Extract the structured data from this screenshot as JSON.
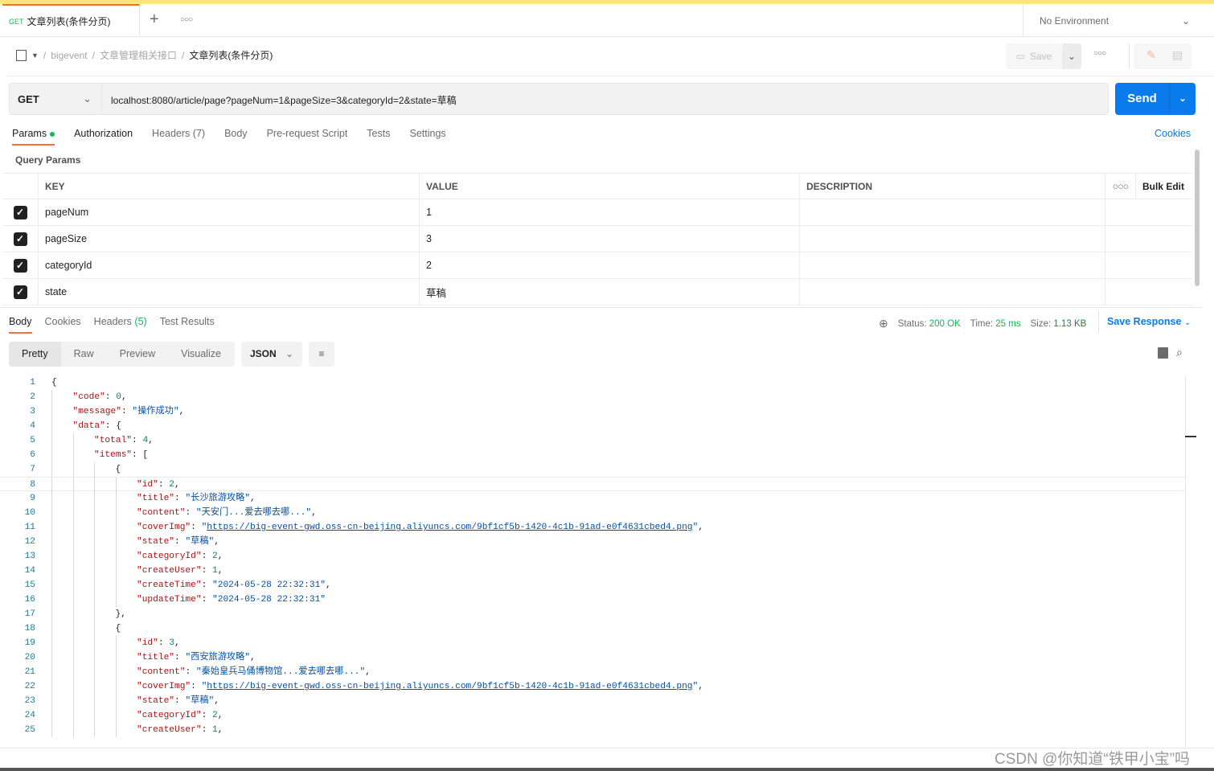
{
  "tab": {
    "method": "GET",
    "title": "文章列表(条件分页)"
  },
  "environment": "No Environment",
  "breadcrumb": [
    "bigevent",
    "文章管理相关接口",
    "文章列表(条件分页)"
  ],
  "toolbar": {
    "save": "Save"
  },
  "request": {
    "method": "GET",
    "url": "localhost:8080/article/page?pageNum=1&pageSize=3&categoryId=2&state=草稿",
    "send": "Send"
  },
  "request_tabs": {
    "params": "Params",
    "authorization": "Authorization",
    "headers": "Headers",
    "headers_count": "(7)",
    "body": "Body",
    "prerequest": "Pre-request Script",
    "tests": "Tests",
    "settings": "Settings",
    "cookies": "Cookies"
  },
  "query_params": {
    "title": "Query Params",
    "headers": {
      "key": "KEY",
      "value": "VALUE",
      "description": "DESCRIPTION",
      "bulk_edit": "Bulk Edit"
    },
    "rows": [
      {
        "key": "pageNum",
        "value": "1",
        "checked": true
      },
      {
        "key": "pageSize",
        "value": "3",
        "checked": true
      },
      {
        "key": "categoryId",
        "value": "2",
        "checked": true
      },
      {
        "key": "state",
        "value": "草稿",
        "checked": true
      }
    ]
  },
  "response_tabs": {
    "body": "Body",
    "cookies": "Cookies",
    "headers": "Headers",
    "headers_count": "(5)",
    "test_results": "Test Results"
  },
  "response_status": {
    "status_label": "Status:",
    "status": "200 OK",
    "time_label": "Time:",
    "time": "25 ms",
    "size_label": "Size:",
    "size": "1.13 KB",
    "save_response": "Save Response"
  },
  "view_modes": {
    "pretty": "Pretty",
    "raw": "Raw",
    "preview": "Preview",
    "visualize": "Visualize",
    "format": "JSON"
  },
  "code_lines": [
    {
      "n": "1",
      "i": 0,
      "t": [
        [
          "p",
          "{"
        ]
      ]
    },
    {
      "n": "2",
      "i": 1,
      "t": [
        [
          "k",
          "\"code\""
        ],
        [
          "p",
          ": "
        ],
        [
          "n",
          "0"
        ],
        [
          "p",
          ","
        ]
      ]
    },
    {
      "n": "3",
      "i": 1,
      "t": [
        [
          "k",
          "\"message\""
        ],
        [
          "p",
          ": "
        ],
        [
          "s",
          "\"操作成功\""
        ],
        [
          "p",
          ","
        ]
      ]
    },
    {
      "n": "4",
      "i": 1,
      "t": [
        [
          "k",
          "\"data\""
        ],
        [
          "p",
          ": {"
        ]
      ]
    },
    {
      "n": "5",
      "i": 2,
      "t": [
        [
          "k",
          "\"total\""
        ],
        [
          "p",
          ": "
        ],
        [
          "n",
          "4"
        ],
        [
          "p",
          ","
        ]
      ]
    },
    {
      "n": "6",
      "i": 2,
      "t": [
        [
          "k",
          "\"items\""
        ],
        [
          "p",
          ": ["
        ]
      ]
    },
    {
      "n": "7",
      "i": 3,
      "t": [
        [
          "p",
          "{"
        ]
      ]
    },
    {
      "n": "8",
      "i": 4,
      "t": [
        [
          "k",
          "\"id\""
        ],
        [
          "p",
          ": "
        ],
        [
          "n",
          "2"
        ],
        [
          "p",
          ","
        ]
      ]
    },
    {
      "n": "9",
      "i": 4,
      "t": [
        [
          "k",
          "\"title\""
        ],
        [
          "p",
          ": "
        ],
        [
          "s",
          "\"长沙旅游攻略\""
        ],
        [
          "p",
          ","
        ]
      ]
    },
    {
      "n": "10",
      "i": 4,
      "t": [
        [
          "k",
          "\"content\""
        ],
        [
          "p",
          ": "
        ],
        [
          "s",
          "\"天安门...爱去哪去哪...\""
        ],
        [
          "p",
          ","
        ]
      ]
    },
    {
      "n": "11",
      "i": 4,
      "t": [
        [
          "k",
          "\"coverImg\""
        ],
        [
          "p",
          ": "
        ],
        [
          "s",
          "\""
        ],
        [
          "u",
          "https://big-event-gwd.oss-cn-beijing.aliyuncs.com/9bf1cf5b-1420-4c1b-91ad-e0f4631cbed4.png"
        ],
        [
          "s",
          "\""
        ],
        [
          "p",
          ","
        ]
      ]
    },
    {
      "n": "12",
      "i": 4,
      "t": [
        [
          "k",
          "\"state\""
        ],
        [
          "p",
          ": "
        ],
        [
          "s",
          "\"草稿\""
        ],
        [
          "p",
          ","
        ]
      ]
    },
    {
      "n": "13",
      "i": 4,
      "t": [
        [
          "k",
          "\"categoryId\""
        ],
        [
          "p",
          ": "
        ],
        [
          "n",
          "2"
        ],
        [
          "p",
          ","
        ]
      ]
    },
    {
      "n": "14",
      "i": 4,
      "t": [
        [
          "k",
          "\"createUser\""
        ],
        [
          "p",
          ": "
        ],
        [
          "n",
          "1"
        ],
        [
          "p",
          ","
        ]
      ]
    },
    {
      "n": "15",
      "i": 4,
      "t": [
        [
          "k",
          "\"createTime\""
        ],
        [
          "p",
          ": "
        ],
        [
          "s",
          "\"2024-05-28 22:32:31\""
        ],
        [
          "p",
          ","
        ]
      ]
    },
    {
      "n": "16",
      "i": 4,
      "t": [
        [
          "k",
          "\"updateTime\""
        ],
        [
          "p",
          ": "
        ],
        [
          "s",
          "\"2024-05-28 22:32:31\""
        ]
      ]
    },
    {
      "n": "17",
      "i": 3,
      "t": [
        [
          "p",
          "},"
        ]
      ]
    },
    {
      "n": "18",
      "i": 3,
      "t": [
        [
          "p",
          "{"
        ]
      ]
    },
    {
      "n": "19",
      "i": 4,
      "t": [
        [
          "k",
          "\"id\""
        ],
        [
          "p",
          ": "
        ],
        [
          "n",
          "3"
        ],
        [
          "p",
          ","
        ]
      ]
    },
    {
      "n": "20",
      "i": 4,
      "t": [
        [
          "k",
          "\"title\""
        ],
        [
          "p",
          ": "
        ],
        [
          "s",
          "\"西安旅游攻略\""
        ],
        [
          "p",
          ","
        ]
      ]
    },
    {
      "n": "21",
      "i": 4,
      "t": [
        [
          "k",
          "\"content\""
        ],
        [
          "p",
          ": "
        ],
        [
          "s",
          "\"秦始皇兵马俑博物馆...爱去哪去哪...\""
        ],
        [
          "p",
          ","
        ]
      ]
    },
    {
      "n": "22",
      "i": 4,
      "t": [
        [
          "k",
          "\"coverImg\""
        ],
        [
          "p",
          ": "
        ],
        [
          "s",
          "\""
        ],
        [
          "u",
          "https://big-event-gwd.oss-cn-beijing.aliyuncs.com/9bf1cf5b-1420-4c1b-91ad-e0f4631cbed4.png"
        ],
        [
          "s",
          "\""
        ],
        [
          "p",
          ","
        ]
      ]
    },
    {
      "n": "23",
      "i": 4,
      "t": [
        [
          "k",
          "\"state\""
        ],
        [
          "p",
          ": "
        ],
        [
          "s",
          "\"草稿\""
        ],
        [
          "p",
          ","
        ]
      ]
    },
    {
      "n": "24",
      "i": 4,
      "t": [
        [
          "k",
          "\"categoryId\""
        ],
        [
          "p",
          ": "
        ],
        [
          "n",
          "2"
        ],
        [
          "p",
          ","
        ]
      ]
    },
    {
      "n": "25",
      "i": 4,
      "t": [
        [
          "k",
          "\"createUser\""
        ],
        [
          "p",
          ": "
        ],
        [
          "n",
          "1"
        ],
        [
          "p",
          ","
        ]
      ]
    }
  ],
  "watermark": "CSDN @你知道“铁甲小宝”吗",
  "colors": {
    "accent": "#ff6c37",
    "send": "#097bed",
    "success": "#0cbb52",
    "json_key": "#a31515",
    "json_string": "#0451a5",
    "json_number": "#098658"
  }
}
